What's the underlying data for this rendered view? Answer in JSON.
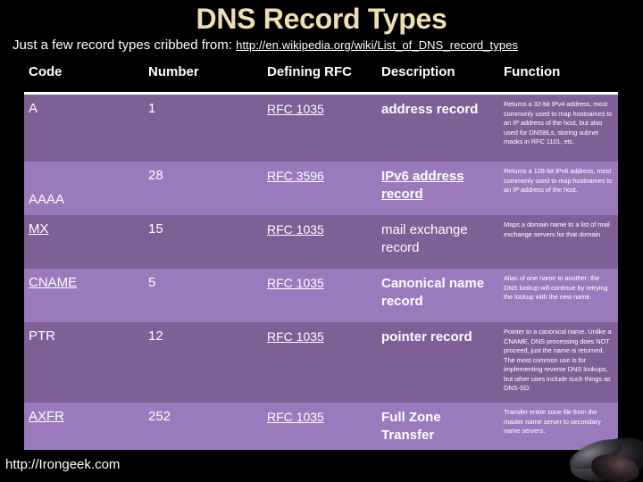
{
  "slide": {
    "title": "DNS Record Types",
    "subtitle_text": "Just a few record types cribbed from:",
    "subtitle_link": "http://en.wikipedia.org/wiki/List_of_DNS_record_types",
    "footer_url": "http://Irongeek.com"
  },
  "colors": {
    "background": "#000000",
    "title": "#efdfb4",
    "row_dark": "#7e5f96",
    "row_light": "#9b79bd",
    "text": "#ffffff",
    "header_rule": "#ffffff"
  },
  "table": {
    "headers": [
      "Code",
      "Number",
      "Defining RFC",
      "Description",
      "Function"
    ],
    "rows": [
      {
        "code": "A",
        "number": "1",
        "rfc": "RFC 1035",
        "description": "address record",
        "function": "Returns a 32-bit IPv4 address, most commonly used to map hostnames to an IP address of the host, but also used for DNSBLs, storing subnet masks in RFC 1101, etc."
      },
      {
        "code": "AAAA",
        "number": "28",
        "rfc": "RFC 3596",
        "description": "IPv6 address record",
        "function": "Returns a 128-bit IPv6 address, most commonly used to map hostnames to an IP address of the host."
      },
      {
        "code": "MX",
        "number": "15",
        "rfc": "RFC 1035",
        "description": "mail exchange record",
        "function": "Maps a domain name to a list of mail exchange servers for that domain"
      },
      {
        "code": "CNAME",
        "number": "5",
        "rfc": "RFC 1035",
        "description": "Canonical name record",
        "function": "Alias of one name to another: the DNS lookup will continue by retrying the lookup with the new name."
      },
      {
        "code": "PTR",
        "number": "12",
        "rfc": "RFC 1035",
        "description": "pointer record",
        "function": "Pointer to a canonical name. Unlike a CNAME, DNS processing does NOT proceed, just the name is returned. The most common use is for implementing reverse DNS lookups, but other uses include such things as DNS-SD."
      },
      {
        "code": "AXFR",
        "number": "252",
        "rfc": "RFC 1035",
        "description": "Full Zone Transfer",
        "function": "Transfer entire zone file from the master name server to secondary name servers."
      }
    ]
  },
  "decor": {
    "corner_image_name": "dark-photo-corner-art"
  }
}
